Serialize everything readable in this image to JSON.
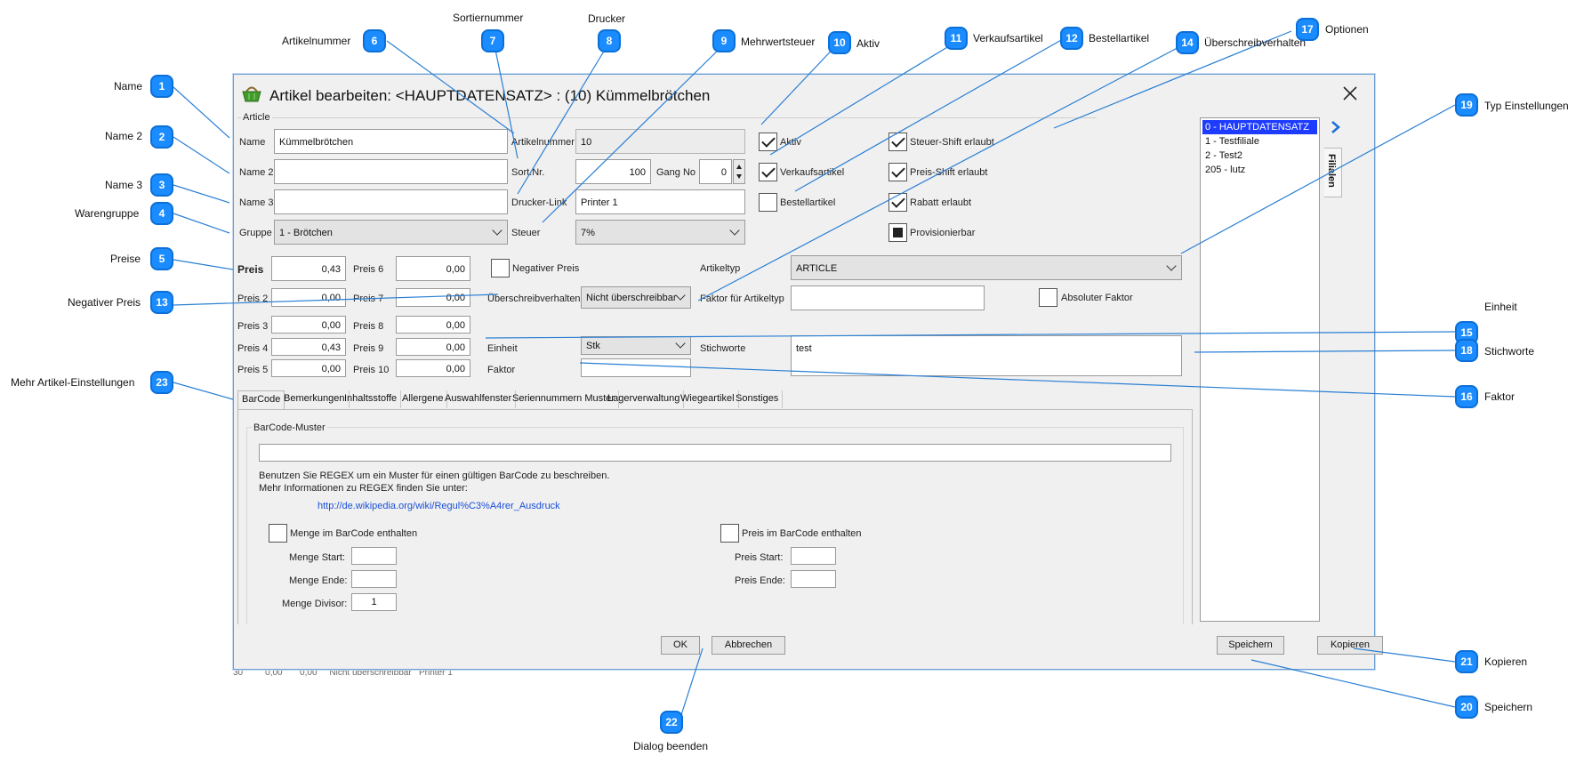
{
  "dialog": {
    "title": "Artikel bearbeiten: <HAUPTDATENSATZ> : (10) Kümmelbrötchen",
    "group_title": "Article",
    "tab_side": "Filialen"
  },
  "fields": {
    "name_label": "Name",
    "name_value": "Kümmelbrötchen",
    "name2_label": "Name 2",
    "name2_value": "",
    "name3_label": "Name 3",
    "name3_value": "",
    "gruppe_label": "Gruppe",
    "gruppe_value": "1 - Brötchen",
    "artikelnummer_label": "Artikelnummer",
    "artikelnummer_value": "10",
    "sortnr_label": "Sort.Nr.",
    "sortnr_value": "100",
    "gangno_label": "Gang No",
    "gangno_value": "0",
    "druckerlink_label": "Drucker-Link",
    "druckerlink_value": "Printer 1",
    "steuer_label": "Steuer",
    "steuer_value": "7%"
  },
  "checks": {
    "aktiv": "Aktiv",
    "verkaufsartikel": "Verkaufsartikel",
    "bestellartikel": "Bestellartikel",
    "steuer_shift": "Steuer-Shift erlaubt",
    "preis_shift": "Preis-Shift erlaubt",
    "rabatt": "Rabatt erlaubt",
    "provisionierbar": "Provisionierbar"
  },
  "prices": {
    "preis_label": "Preis",
    "preis": "0,43",
    "preis2_label": "Preis 2",
    "preis2": "0,00",
    "preis3_label": "Preis 3",
    "preis3": "0,00",
    "preis4_label": "Preis 4",
    "preis4": "0,43",
    "preis5_label": "Preis 5",
    "preis5": "0,00",
    "preis6_label": "Preis 6",
    "preis6": "0,00",
    "preis7_label": "Preis 7",
    "preis7": "0,00",
    "preis8_label": "Preis 8",
    "preis8": "0,00",
    "preis9_label": "Preis 9",
    "preis9": "0,00",
    "preis10_label": "Preis 10",
    "preis10": "0,00"
  },
  "settings": {
    "negativer_preis": "Negativer Preis",
    "ueberschreib_label": "Überschreibverhalten",
    "ueberschreib_value": "Nicht überschreibbar",
    "einheit_label": "Einheit",
    "einheit_value": "Stk",
    "faktor_label": "Faktor",
    "faktor_value": "",
    "artikeltyp_label": "Artikeltyp",
    "artikeltyp_value": "ARTICLE",
    "faktor_typ_label": "Faktor für Artikeltyp",
    "faktor_typ_value": "",
    "absoluter_faktor": "Absoluter Faktor",
    "stichworte_label": "Stichworte",
    "stichworte_value": "test"
  },
  "tabs": [
    "BarCode",
    "Bemerkungen",
    "Inhaltsstoffe",
    "Allergene",
    "Auswahlfenster",
    "Seriennummern Muster",
    "Lagerverwaltung",
    "Wiegeartikel",
    "Sonstiges"
  ],
  "barcode": {
    "group_title": "BarCode-Muster",
    "pattern_value": "",
    "help_line1": "Benutzen Sie REGEX um ein Muster für einen gültigen BarCode zu beschreiben.",
    "help_line2": "Mehr Informationen zu REGEX finden Sie unter:",
    "link": "http://de.wikipedia.org/wiki/Regul%C3%A4rer_Ausdruck",
    "menge_check": "Menge im BarCode enthalten",
    "menge_start": "Menge Start:",
    "menge_ende": "Menge Ende:",
    "menge_divisor": "Menge Divisor:",
    "menge_divisor_value": "1",
    "preis_check": "Preis im BarCode enthalten",
    "preis_start": "Preis Start:",
    "preis_ende": "Preis Ende:"
  },
  "buttons": {
    "ok": "OK",
    "abbrechen": "Abbrechen",
    "speichern": "Speichern",
    "kopieren": "Kopieren"
  },
  "branches": [
    "0 - HAUPTDATENSATZ",
    "1 - Testfiliale",
    "2 - Test2",
    "205 - lutz"
  ],
  "annotations": {
    "a1": "Name",
    "a2": "Name 2",
    "a3": "Name 3",
    "a4": "Warengruppe",
    "a5": "Preise",
    "a6": "Artikelnummer",
    "a7": "Sortiernummer",
    "a8": "Drucker",
    "a9": "Mehrwertsteuer",
    "a10": "Aktiv",
    "a11": "Verkaufsartikel",
    "a12": "Bestellartikel",
    "a13": "Negativer Preis",
    "a14": "Überschreibverhalten",
    "a15": "Einheit",
    "a16": "Faktor",
    "a17": "Optionen",
    "a18": "Stichworte",
    "a19": "Typ Einstellungen",
    "a20": "Speichern",
    "a21": "Kopieren",
    "a22": "Dialog beenden",
    "a23": "Mehr Artikel-Einstellungen"
  },
  "markers": [
    "1",
    "2",
    "3",
    "4",
    "5",
    "6",
    "7",
    "8",
    "9",
    "10",
    "11",
    "12",
    "13",
    "14",
    "15",
    "16",
    "17",
    "18",
    "19",
    "20",
    "21",
    "22",
    "23"
  ]
}
